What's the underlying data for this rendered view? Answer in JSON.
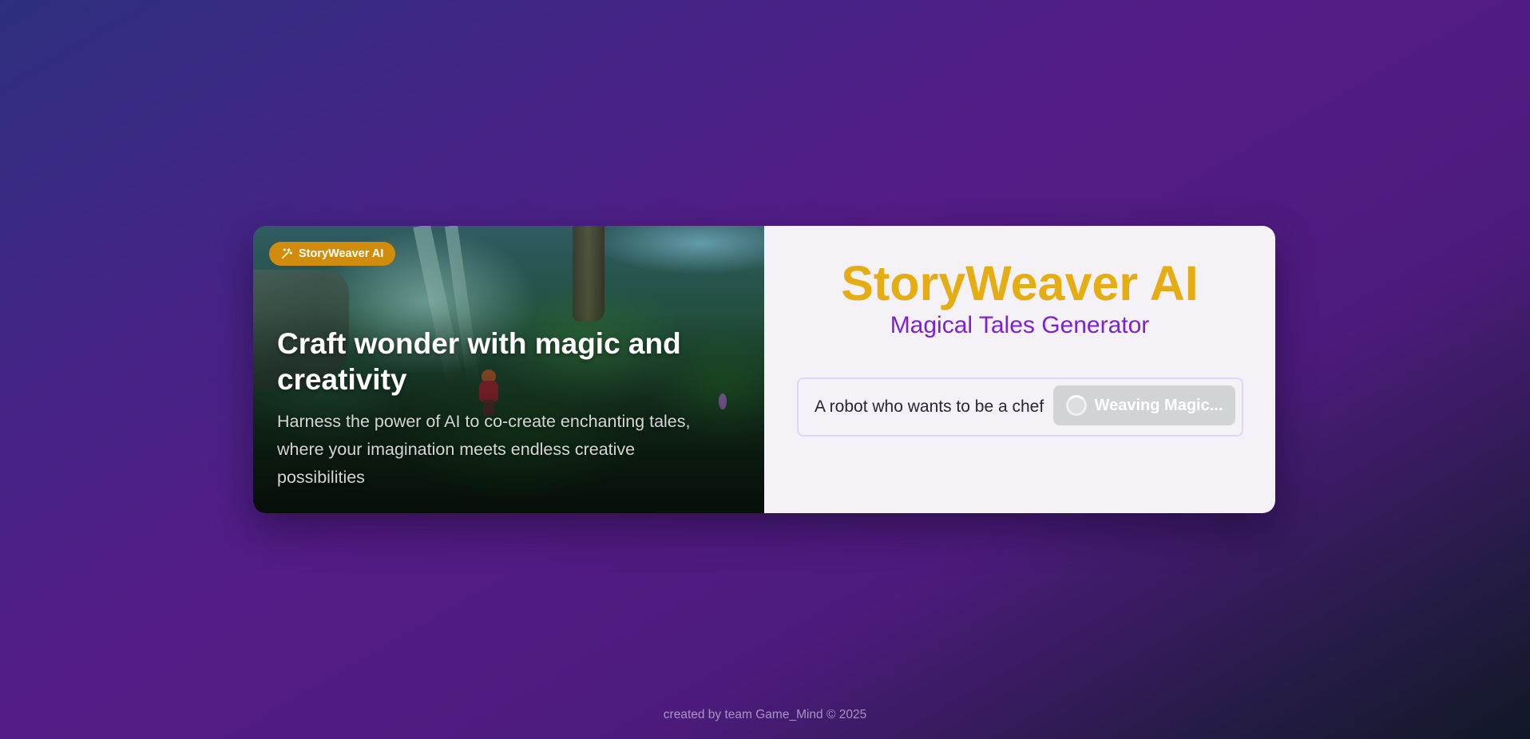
{
  "hero": {
    "badge_label": "StoryWeaver AI",
    "badge_icon": "magic-wand-icon",
    "title": "Craft wonder with magic and creativity",
    "subtitle": "Harness the power of AI to co-create enchanting tales, where your imagination meets endless creative possibilities"
  },
  "panel": {
    "title": "StoryWeaver AI",
    "subtitle": "Magical Tales Generator",
    "prompt_value": "A robot who wants to be a chef",
    "button_label": "Weaving Magic...",
    "button_icon": "loading-spinner-icon"
  },
  "footer": {
    "text": "created by team Game_Mind © 2025"
  },
  "colors": {
    "accent_gold": "#e6ad12",
    "accent_purple": "#7e22ce",
    "badge_bg": "#d08c0a",
    "button_disabled": "#d2d3d7"
  }
}
